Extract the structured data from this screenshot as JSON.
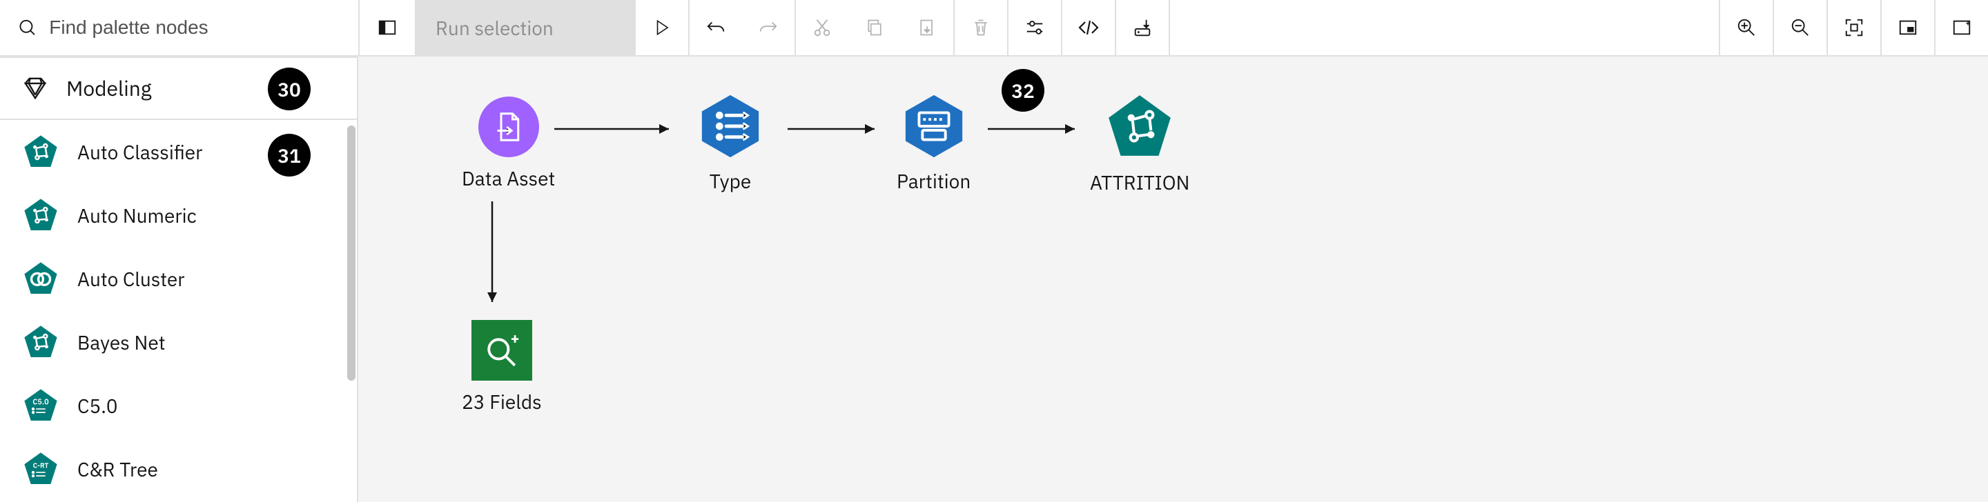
{
  "colors": {
    "purple": "#9f62fe",
    "blue": "#1f70c1",
    "teal": "#007d79",
    "green": "#198038",
    "grey_bg": "#f4f4f4"
  },
  "toolbar": {
    "search_placeholder": "Find palette nodes",
    "run_selection_label": "Run selection"
  },
  "sidebar": {
    "header": "Modeling",
    "items": [
      {
        "label": "Auto Classifier"
      },
      {
        "label": "Auto Numeric"
      },
      {
        "label": "Auto Cluster"
      },
      {
        "label": "Bayes Net"
      },
      {
        "label": "C5.0"
      },
      {
        "label": "C&R Tree"
      }
    ]
  },
  "canvas": {
    "nodes": {
      "data_asset": "Data Asset",
      "type": "Type",
      "partition": "Partition",
      "attrition": "ATTRITION",
      "fields": "23 Fields"
    }
  },
  "badges": {
    "b30": "30",
    "b31": "31",
    "b32": "32"
  }
}
